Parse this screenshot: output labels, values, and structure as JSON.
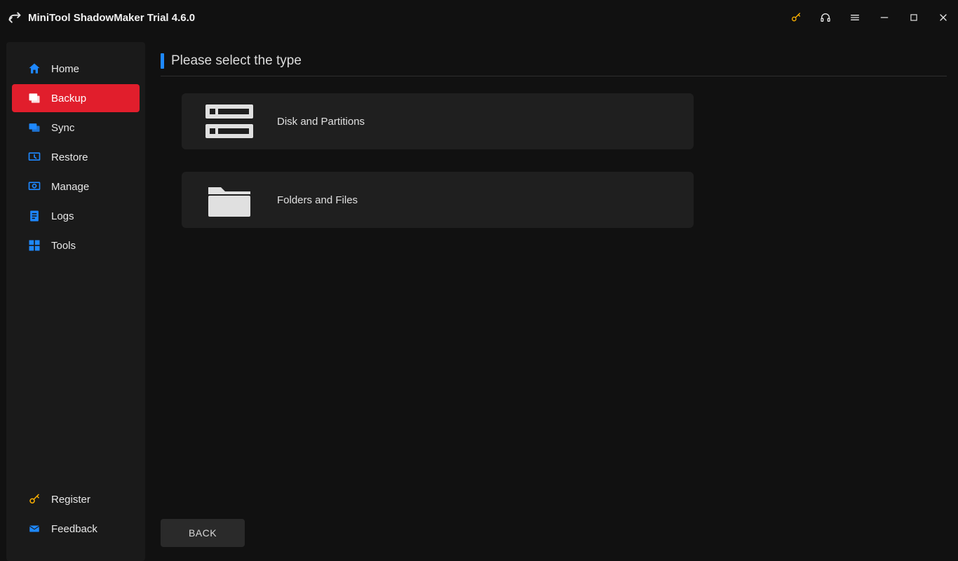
{
  "app": {
    "title": "MiniTool ShadowMaker Trial 4.6.0"
  },
  "sidebar": {
    "items": [
      {
        "label": "Home"
      },
      {
        "label": "Backup"
      },
      {
        "label": "Sync"
      },
      {
        "label": "Restore"
      },
      {
        "label": "Manage"
      },
      {
        "label": "Logs"
      },
      {
        "label": "Tools"
      }
    ],
    "footer": [
      {
        "label": "Register"
      },
      {
        "label": "Feedback"
      }
    ]
  },
  "main": {
    "heading": "Please select the type",
    "options": [
      {
        "label": "Disk and Partitions"
      },
      {
        "label": "Folders and Files"
      }
    ],
    "back_label": "BACK"
  }
}
